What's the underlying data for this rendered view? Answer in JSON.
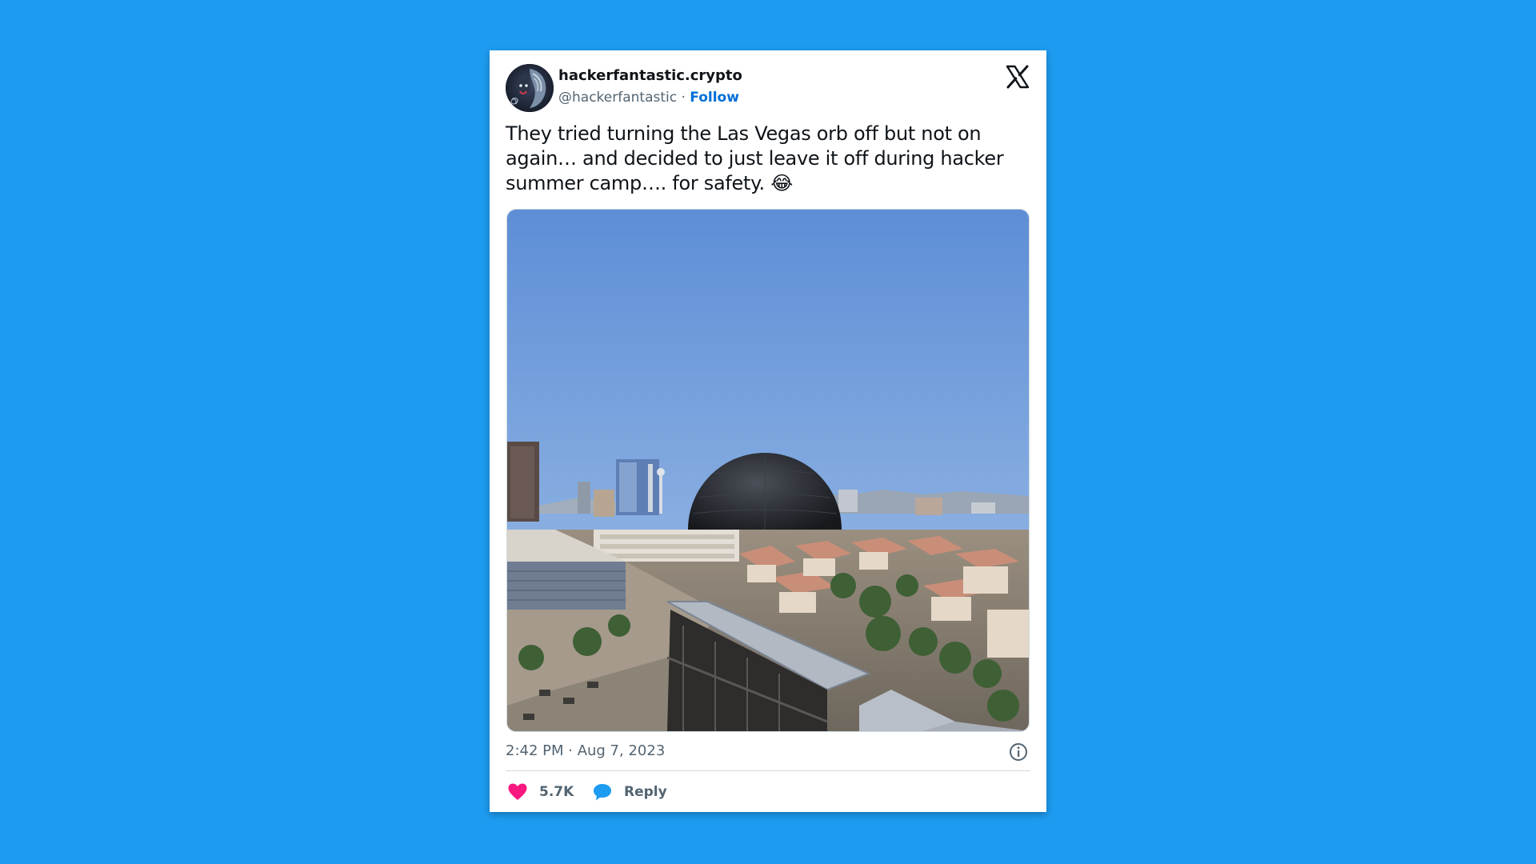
{
  "colors": {
    "background": "#1d9bf0",
    "card": "#ffffff",
    "text_primary": "#0f1419",
    "text_secondary": "#536471",
    "follow": "#006fd6",
    "like": "#f91880",
    "reply": "#1d9bf0"
  },
  "tweet": {
    "author": {
      "display_name": "hackerfantastic.crypto",
      "handle": "@hackerfantastic",
      "separator": "·",
      "follow_label": "Follow",
      "avatar_icon": "cat-avatar"
    },
    "platform_icon": "x-logo-icon",
    "text": "They tried turning the Las Vegas orb off but not on again… and decided to just leave it off during hacker summer camp…. for safety. 😂",
    "image_icon": "las-vegas-sphere-photo",
    "timestamp": "2:42 PM · Aug 7, 2023",
    "info_icon": "info-icon",
    "actions": {
      "like_icon": "heart-icon",
      "like_count": "5.7K",
      "reply_icon": "speech-bubble-icon",
      "reply_label": "Reply"
    }
  }
}
